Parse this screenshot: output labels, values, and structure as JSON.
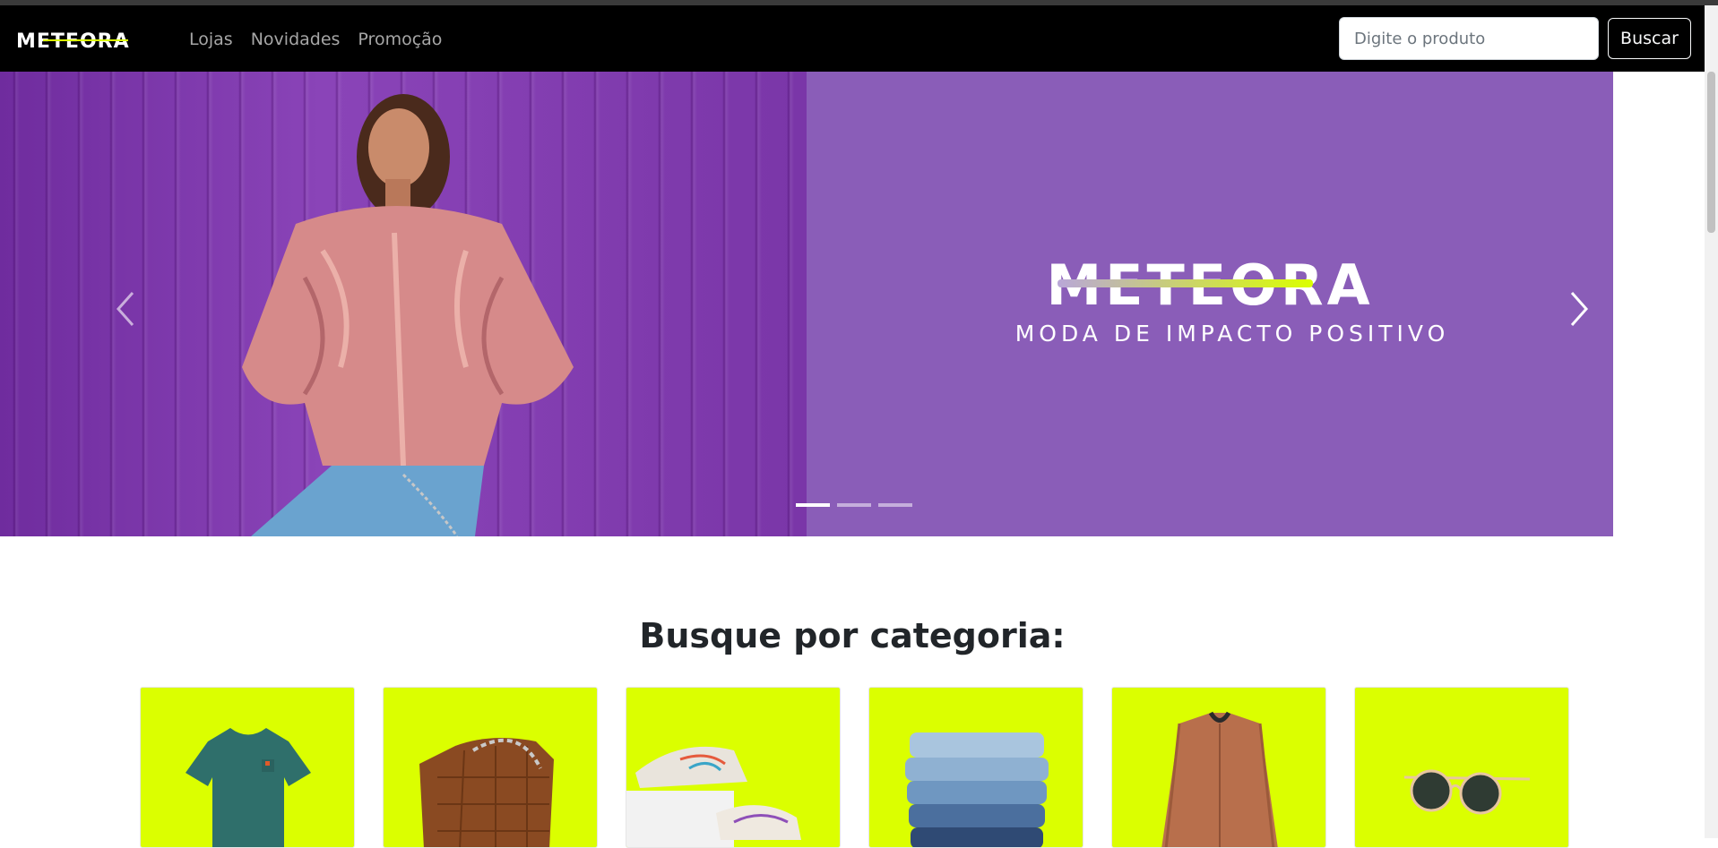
{
  "brand": {
    "name": "METEORA",
    "accent": "#dbff00"
  },
  "nav": {
    "links": [
      "Lojas",
      "Novidades",
      "Promoção"
    ]
  },
  "search": {
    "placeholder": "Digite o produto",
    "value": "",
    "button_label": "Buscar"
  },
  "carousel": {
    "banner_title": "METEORA",
    "banner_tagline": "MODA DE IMPACTO POSITIVO",
    "banner_color": "#8a5db8",
    "slide_count": 3,
    "active_slide": 1,
    "prev_icon": "chevron-left-icon",
    "next_icon": "chevron-right-icon"
  },
  "categories": {
    "title": "Busque por categoria:",
    "card_color": "#dbff00",
    "items": [
      "t-shirt",
      "handbag",
      "sneakers",
      "jeans",
      "jacket",
      "sunglasses"
    ]
  }
}
